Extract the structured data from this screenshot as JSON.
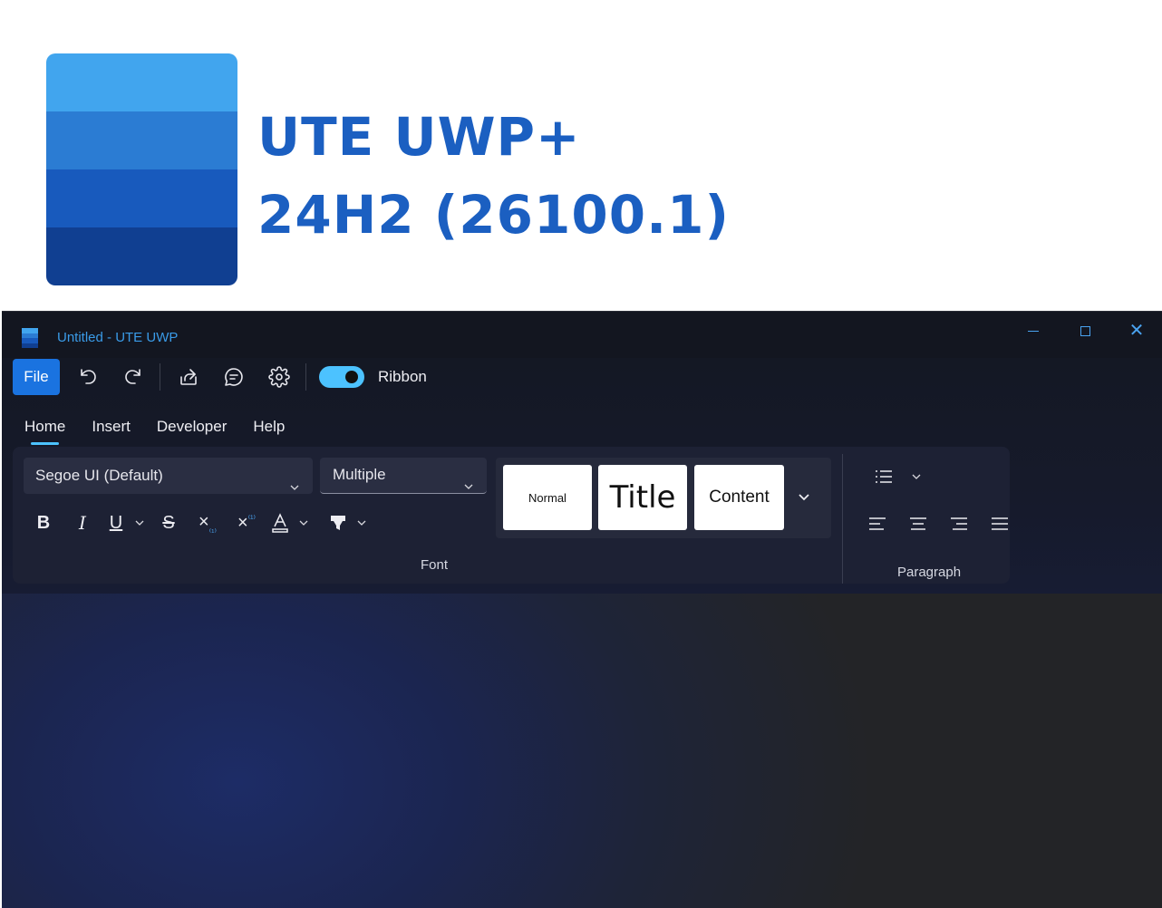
{
  "banner": {
    "line1": "UTE UWP+",
    "line2": "24H2 (26100.1)",
    "logo_colors": [
      "#41a5ee",
      "#2b7cd3",
      "#185abd",
      "#103f91"
    ]
  },
  "window": {
    "title": "Untitled - UTE UWP",
    "controls": {
      "minimize": "minimize-icon",
      "maximize": "maximize-icon",
      "close": "close-icon"
    }
  },
  "quickbar": {
    "file_label": "File",
    "icons": [
      "undo-icon",
      "redo-icon",
      "share-icon",
      "comment-icon",
      "gear-icon"
    ],
    "toggle_label": "Ribbon",
    "toggle_on": true,
    "accent": "#4cc2ff"
  },
  "tabs": [
    {
      "label": "Home",
      "active": true
    },
    {
      "label": "Insert",
      "active": false
    },
    {
      "label": "Developer",
      "active": false
    },
    {
      "label": "Help",
      "active": false
    }
  ],
  "ribbon": {
    "font": {
      "family": "Segoe UI (Default)",
      "size": "Multiple",
      "group_label": "Font",
      "format_icons": [
        "bold-icon",
        "italic-icon",
        "underline-icon",
        "strikethrough-icon",
        "subscript-icon",
        "superscript-icon",
        "font-color-icon",
        "highlight-icon"
      ]
    },
    "styles": {
      "items": [
        "Normal",
        "Title",
        "Content"
      ]
    },
    "paragraph": {
      "group_label": "Paragraph",
      "icons": [
        "list-icon",
        "align-left-icon",
        "align-center-icon",
        "align-right-icon",
        "justify-icon"
      ]
    }
  }
}
